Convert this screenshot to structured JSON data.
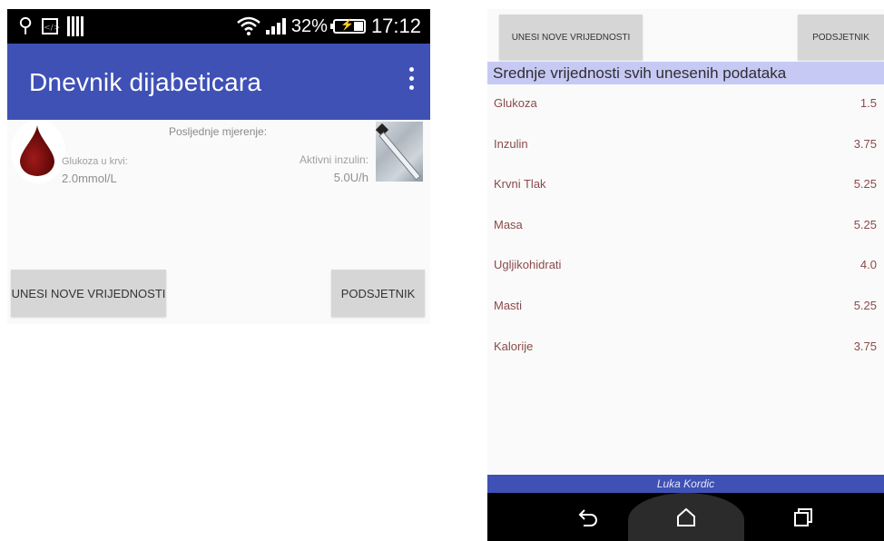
{
  "left": {
    "statusbar": {
      "battery_percent": "32%",
      "time": "17:12"
    },
    "appbar": {
      "title": "Dnevnik dijabeticara"
    },
    "last_measurement_label": "Posljednje mjerenje:",
    "glucose": {
      "label": "Glukoza u krvi:",
      "value": "2.0mmol/L"
    },
    "insulin": {
      "label": "Aktivni inzulin:",
      "value": "5.0U/h"
    },
    "buttons": {
      "new_values": "UNESI NOVE VRIJEDNOSTI",
      "reminder": "PODSJETNIK"
    }
  },
  "right": {
    "buttons": {
      "new_values": "UNESI NOVE VRIJEDNOSTI",
      "reminder": "PODSJETNIK"
    },
    "header": "Srednje vrijednosti svih unesenih podataka",
    "averages": [
      {
        "label": "Glukoza",
        "value": "1.5"
      },
      {
        "label": "Inzulin",
        "value": "3.75"
      },
      {
        "label": "Krvni Tlak",
        "value": "5.25"
      },
      {
        "label": "Masa",
        "value": "5.25"
      },
      {
        "label": "Ugljikohidrati",
        "value": "4.0"
      },
      {
        "label": "Masti",
        "value": "5.25"
      },
      {
        "label": "Kalorije",
        "value": "3.75"
      }
    ],
    "footer": "Luka Kordic"
  },
  "colors": {
    "appbar": "#3f51b5",
    "header_highlight": "#c7c9f5",
    "list_text": "#8b4a4a",
    "button_bg": "#d6d6d6"
  },
  "icons": [
    "usb-icon",
    "code-icon",
    "barcode-icon",
    "wifi-icon",
    "signal-icon",
    "battery-icon",
    "overflow-menu-icon",
    "blood-drop-icon",
    "syringe-image",
    "back-icon",
    "home-icon",
    "recents-icon"
  ]
}
